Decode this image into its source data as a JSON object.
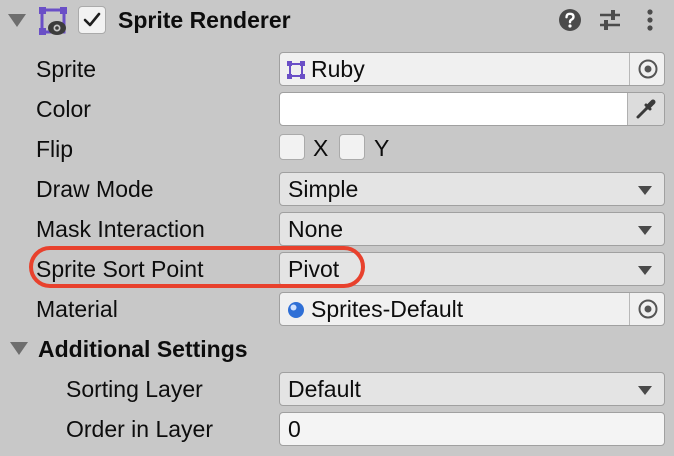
{
  "component": {
    "title": "Sprite Renderer",
    "enabled": true,
    "icon": "sprite-renderer-icon",
    "header_icons": [
      "help-icon",
      "preset-sliders-icon",
      "kebab-menu-icon"
    ]
  },
  "fields": {
    "sprite": {
      "label": "Sprite",
      "value": "Ruby",
      "icon": "sprite-asset-icon"
    },
    "color": {
      "label": "Color",
      "value": "#FFFFFF"
    },
    "flip": {
      "label": "Flip",
      "x_label": "X",
      "y_label": "Y",
      "x_checked": false,
      "y_checked": false
    },
    "draw_mode": {
      "label": "Draw Mode",
      "value": "Simple"
    },
    "mask_interaction": {
      "label": "Mask Interaction",
      "value": "None"
    },
    "sprite_sort_point": {
      "label": "Sprite Sort Point",
      "value": "Pivot"
    },
    "material": {
      "label": "Material",
      "value": "Sprites-Default",
      "icon": "material-sphere-icon"
    }
  },
  "additional_settings": {
    "title": "Additional Settings",
    "sorting_layer": {
      "label": "Sorting Layer",
      "value": "Default"
    },
    "order_in_layer": {
      "label": "Order in Layer",
      "value": "0"
    }
  },
  "colors": {
    "background": "#c8c8c8",
    "highlight": "#e8412d",
    "icon_purple": "#6a4fc7"
  }
}
